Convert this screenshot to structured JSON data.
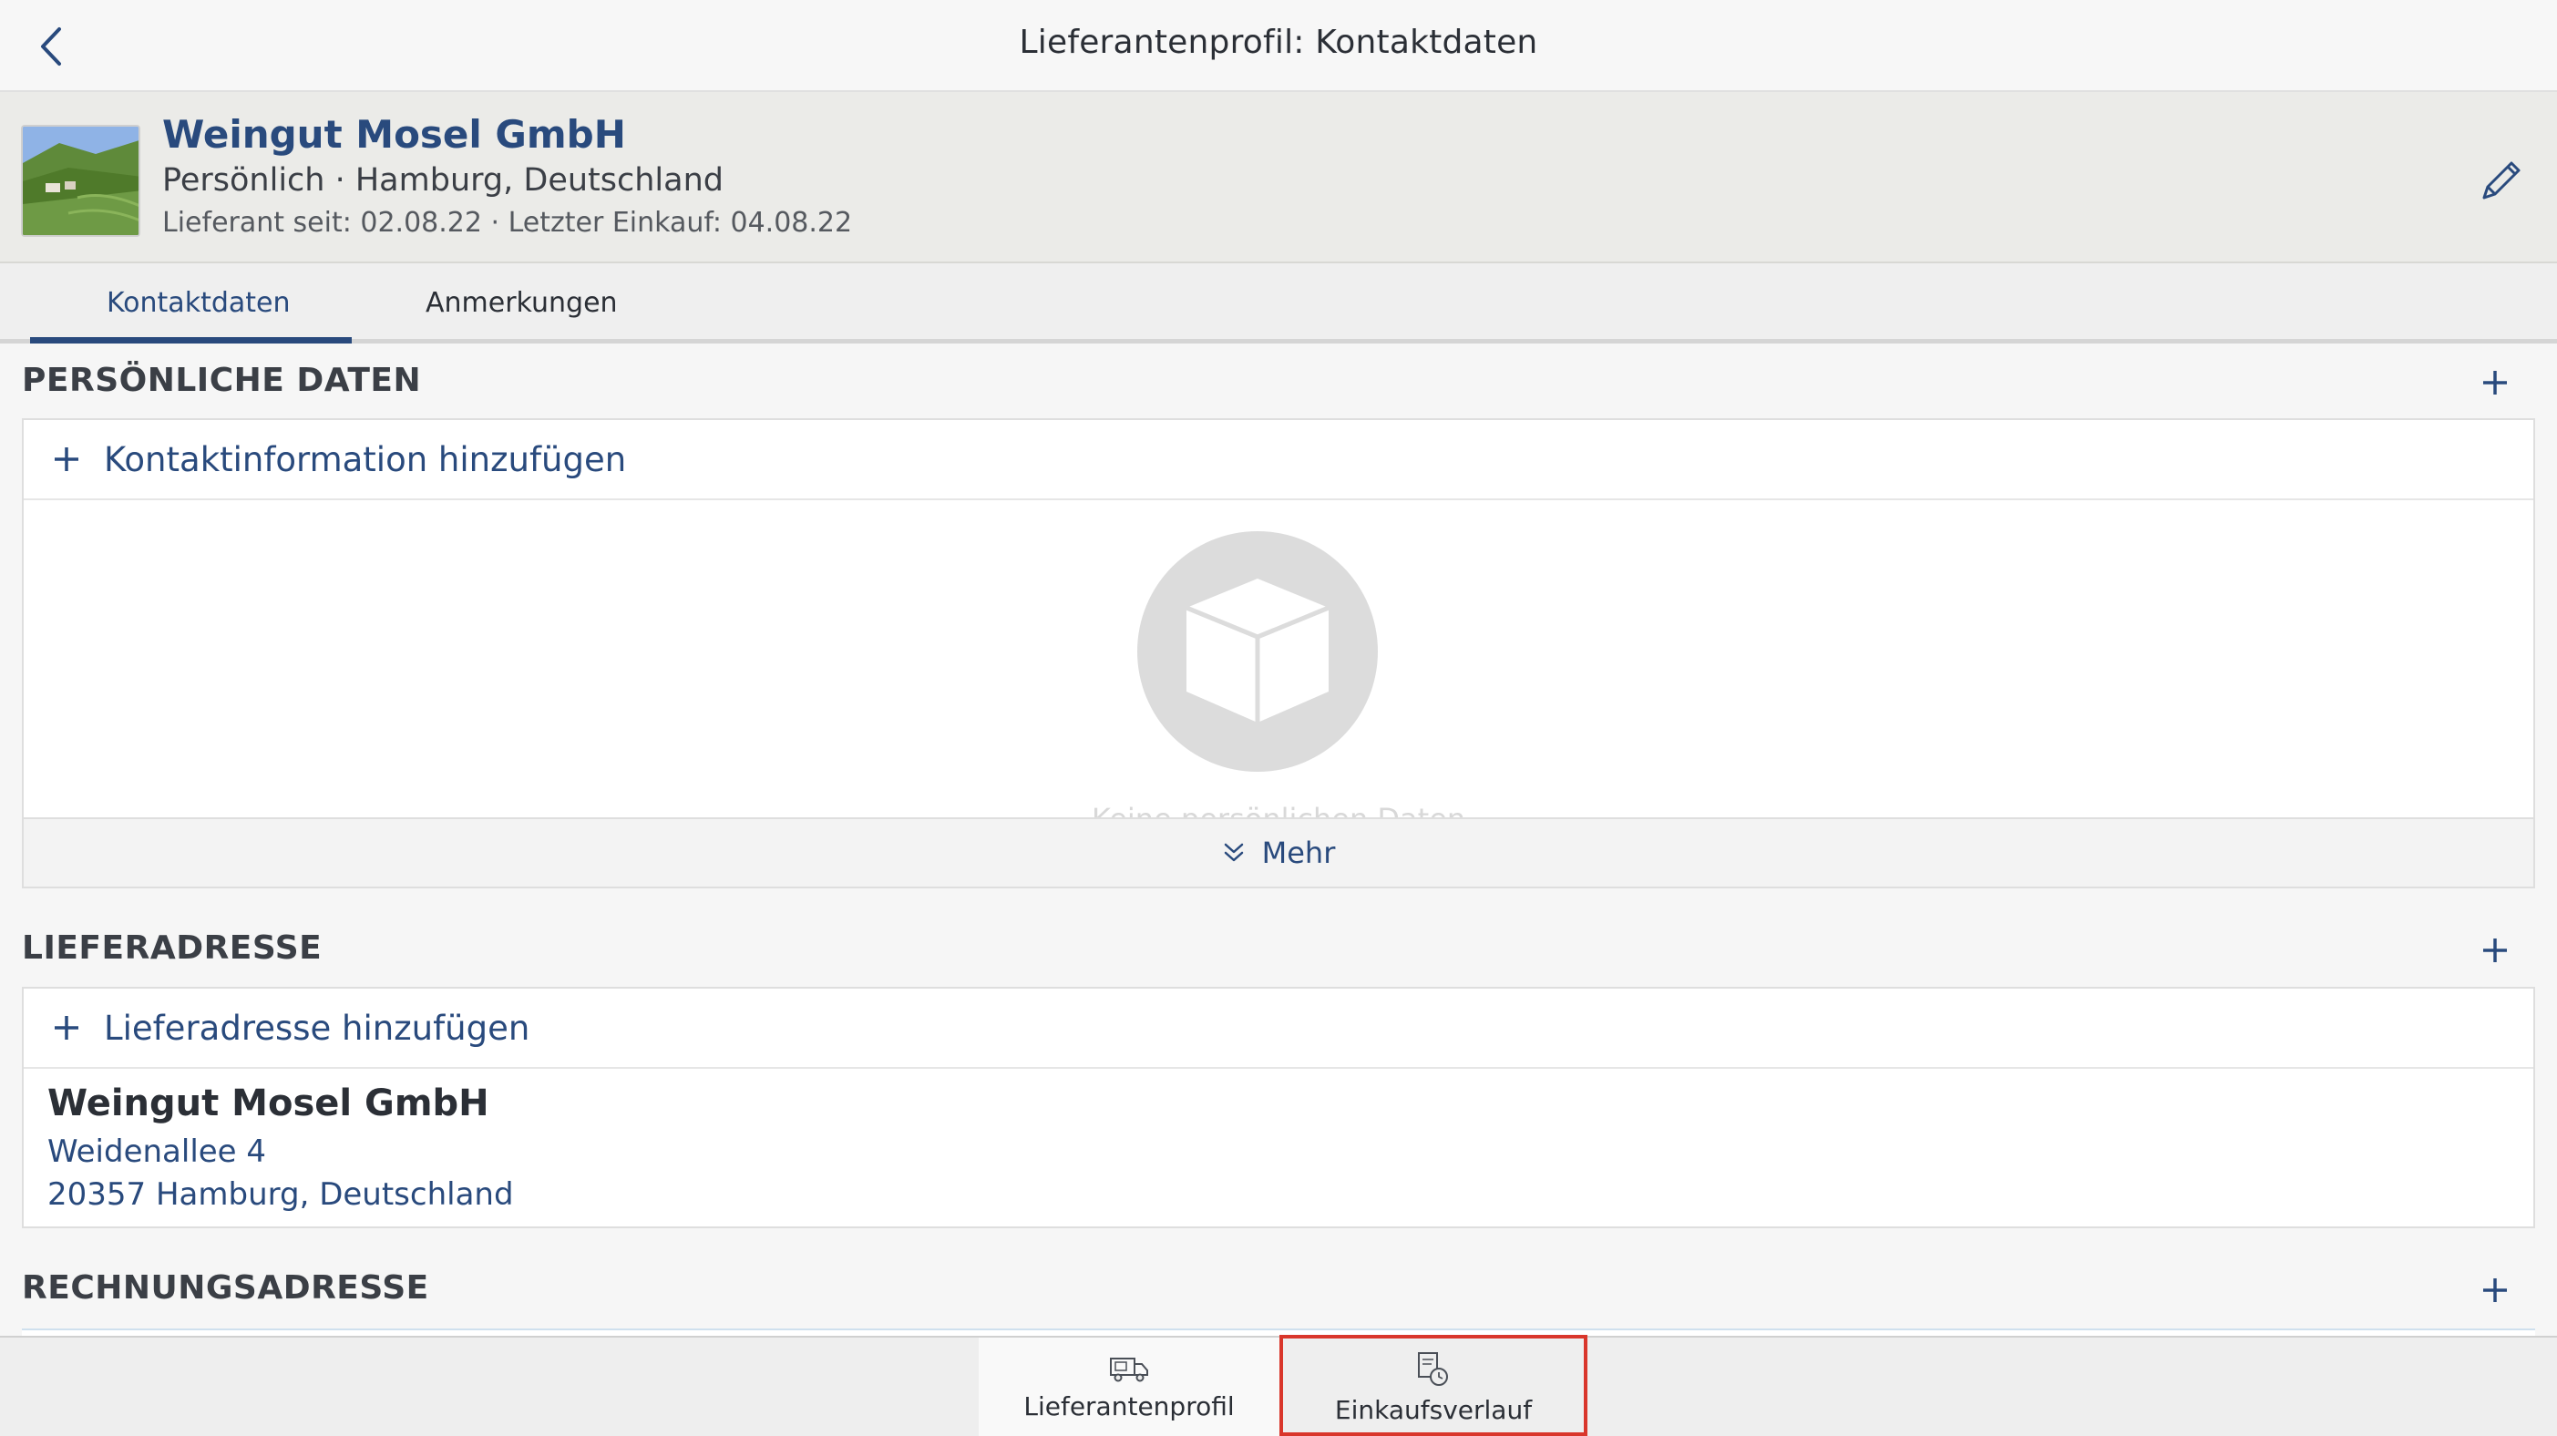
{
  "navbar": {
    "title": "Lieferantenprofil: Kontaktdaten",
    "back_icon": "chevron-left-icon"
  },
  "supplier": {
    "name": "Weingut Mosel GmbH",
    "subtitle": "Persönlich · Hamburg, Deutschland",
    "meta": "Lieferant seit: 02.08.22 · Letzter Einkauf: 04.08.22",
    "edit_icon": "pencil-icon"
  },
  "tabs": [
    {
      "label": "Kontaktdaten",
      "active": true
    },
    {
      "label": "Anmerkungen",
      "active": false
    }
  ],
  "personal": {
    "title": "PERSÖNLICHE DATEN",
    "add_label": "Kontaktinformation hinzufügen",
    "empty_text": "Keine persönlichen Daten",
    "more_label": "Mehr"
  },
  "delivery": {
    "title": "LIEFERADRESSE",
    "add_label": "Lieferadresse hinzufügen",
    "address": {
      "name": "Weingut Mosel GmbH",
      "street": "Weidenallee 4",
      "city": "20357 Hamburg, Deutschland"
    }
  },
  "billing": {
    "title": "RECHNUNGSADRESSE"
  },
  "bottom_tabs": [
    {
      "label": "Lieferantenprofil",
      "icon": "truck-icon",
      "active": true
    },
    {
      "label": "Einkaufsverlauf",
      "icon": "purchase-history-icon",
      "active": false,
      "highlighted": true
    }
  ],
  "colors": {
    "accent": "#294a7d",
    "highlight": "#d9362b"
  }
}
